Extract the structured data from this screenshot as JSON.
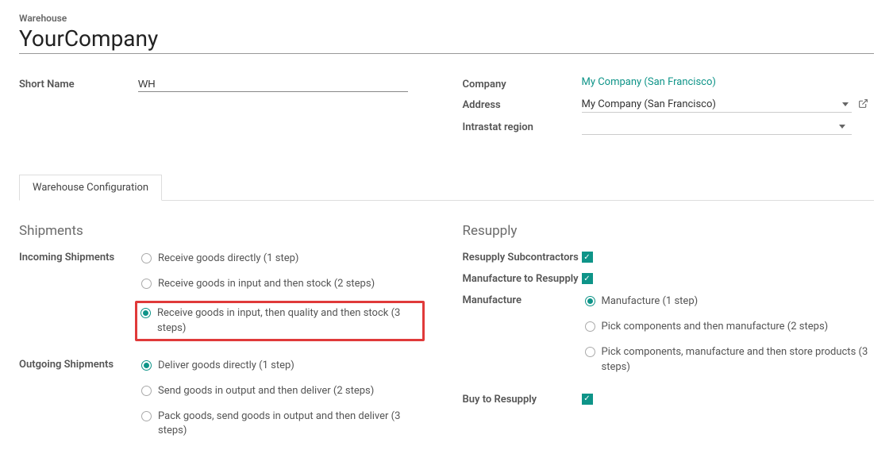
{
  "header": {
    "label": "Warehouse",
    "title": "YourCompany"
  },
  "fields": {
    "short_name": {
      "label": "Short Name",
      "value": "WH"
    },
    "company": {
      "label": "Company",
      "value": "My Company (San Francisco)"
    },
    "address": {
      "label": "Address",
      "value": "My Company (San Francisco)"
    },
    "intrastat": {
      "label": "Intrastat region",
      "value": ""
    }
  },
  "tabs": {
    "config": "Warehouse Configuration"
  },
  "shipments": {
    "title": "Shipments",
    "incoming": {
      "label": "Incoming Shipments",
      "options": [
        "Receive goods directly (1 step)",
        "Receive goods in input and then stock (2 steps)",
        "Receive goods in input, then quality and then stock (3 steps)"
      ]
    },
    "outgoing": {
      "label": "Outgoing Shipments",
      "options": [
        "Deliver goods directly (1 step)",
        "Send goods in output and then deliver (2 steps)",
        "Pack goods, send goods in output and then deliver (3 steps)"
      ]
    }
  },
  "resupply": {
    "title": "Resupply",
    "subcontractors": {
      "label": "Resupply Subcontractors"
    },
    "manufacture_to_resupply": {
      "label": "Manufacture to Resupply"
    },
    "manufacture": {
      "label": "Manufacture",
      "options": [
        "Manufacture (1 step)",
        "Pick components and then manufacture (2 steps)",
        "Pick components, manufacture and then store products (3 steps)"
      ]
    },
    "buy_to_resupply": {
      "label": "Buy to Resupply"
    }
  }
}
